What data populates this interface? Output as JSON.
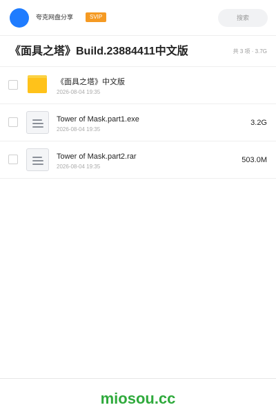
{
  "header": {
    "app_name": "夸克网盘分享",
    "vip_badge": "SVIP",
    "search_placeholder": "搜索",
    "avatar_color": "#1f7cff"
  },
  "share": {
    "title": "《面具之塔》Build.23884411中文版",
    "summary": "共 3 项 · 3.7G"
  },
  "files": [
    {
      "icon": "folder-icon",
      "name": "《面具之塔》中文版",
      "date": "2026-08-04 19:35",
      "size": ""
    },
    {
      "icon": "document-icon",
      "name": "Tower of Mask.part1.exe",
      "date": "2026-08-04 19:35",
      "size": "3.2G"
    },
    {
      "icon": "document-icon",
      "name": "Tower of Mask.part2.rar",
      "date": "2026-08-04 19:35",
      "size": "503.0M"
    }
  ],
  "footer": {
    "watermark": "miosou.cc",
    "watermark_color": "#2faa3c"
  }
}
